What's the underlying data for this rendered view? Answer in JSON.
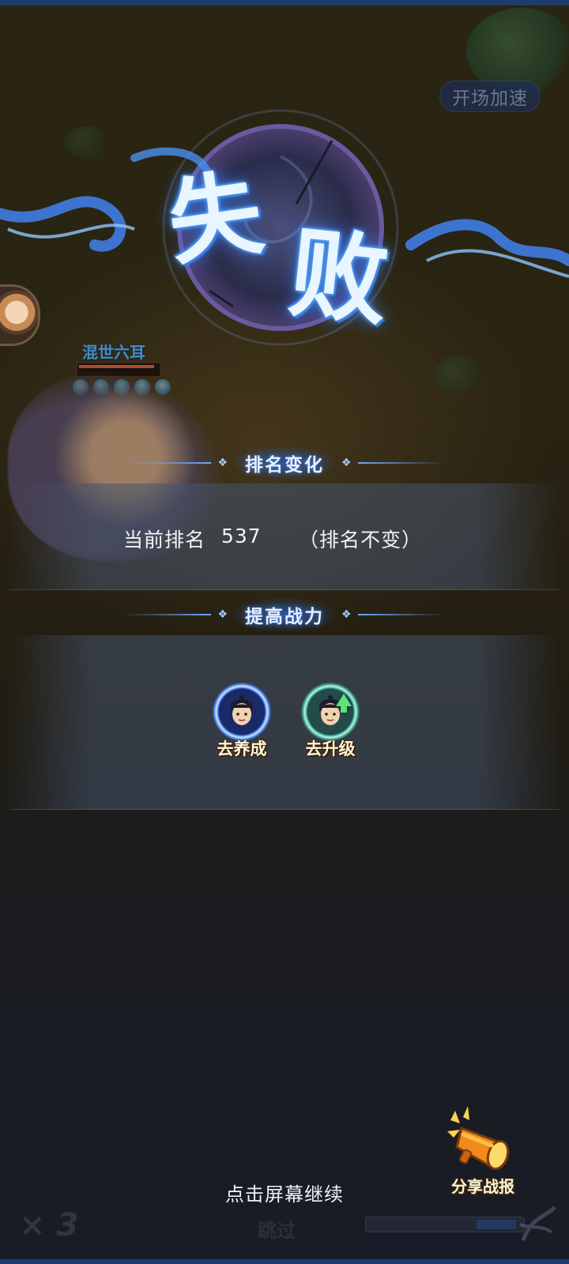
{
  "hud": {
    "speed_button": "开场加速",
    "multiplier": "× 3",
    "skip": "跳过"
  },
  "enemy": {
    "name": "混世六耳",
    "hp_fraction": 0.95
  },
  "result": {
    "title_chars": [
      "失",
      "败"
    ]
  },
  "rank_section": {
    "header": "排名变化",
    "current_label": "当前排名",
    "rank_value": "537",
    "change_note": "（排名不变）"
  },
  "power_section": {
    "header": "提高战力",
    "buttons": [
      {
        "label": "去养成",
        "icon": "hero-nurture-icon"
      },
      {
        "label": "去升级",
        "icon": "hero-upgrade-icon"
      }
    ]
  },
  "footer": {
    "continue_hint": "点击屏幕继续",
    "share_label": "分享战报",
    "share_icon": "megaphone-icon"
  },
  "colors": {
    "title_glow": "#3a82ff",
    "accent_blue": "#6fa8ff",
    "caption_gold": "#fff6d8"
  }
}
